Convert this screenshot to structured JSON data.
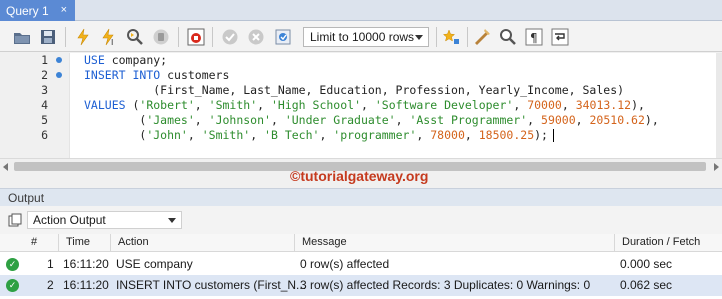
{
  "tab": {
    "label": "Query 1",
    "close": "×"
  },
  "toolbar": {
    "limit_label": "Limit to 10000 rows",
    "icons": [
      "open-folder-icon",
      "save-icon",
      "execute-icon",
      "execute-current-icon",
      "explain-icon",
      "stop-icon",
      "toggle-error-icon",
      "commit-icon",
      "rollback-icon",
      "autocommit-icon",
      "limit-dropdown",
      "beautify-icon",
      "snippet-icon",
      "find-icon",
      "invisible-chars-icon",
      "wrap-icon"
    ]
  },
  "editor": {
    "line_numbers": [
      "1",
      "2",
      "3",
      "4",
      "5",
      "6"
    ],
    "lines": [
      [
        {
          "t": "USE",
          "c": "kw"
        },
        {
          "t": " company;",
          "c": "pl"
        }
      ],
      [
        {
          "t": "INSERT INTO",
          "c": "kw"
        },
        {
          "t": " customers",
          "c": "pl"
        }
      ],
      [
        {
          "t": "          (First_Name, Last_Name, Education, Profession, Yearly_Income, Sales)",
          "c": "pl"
        }
      ],
      [
        {
          "t": "VALUES",
          "c": "kw"
        },
        {
          "t": " (",
          "c": "pl"
        },
        {
          "t": "'Robert'",
          "c": "st"
        },
        {
          "t": ", ",
          "c": "pl"
        },
        {
          "t": "'Smith'",
          "c": "st"
        },
        {
          "t": ", ",
          "c": "pl"
        },
        {
          "t": "'High School'",
          "c": "st"
        },
        {
          "t": ", ",
          "c": "pl"
        },
        {
          "t": "'Software Developer'",
          "c": "st"
        },
        {
          "t": ", ",
          "c": "pl"
        },
        {
          "t": "70000",
          "c": "nm"
        },
        {
          "t": ", ",
          "c": "pl"
        },
        {
          "t": "34013.12",
          "c": "nm"
        },
        {
          "t": "),",
          "c": "pl"
        }
      ],
      [
        {
          "t": "        (",
          "c": "pl"
        },
        {
          "t": "'James'",
          "c": "st"
        },
        {
          "t": ", ",
          "c": "pl"
        },
        {
          "t": "'Johnson'",
          "c": "st"
        },
        {
          "t": ", ",
          "c": "pl"
        },
        {
          "t": "'Under Graduate'",
          "c": "st"
        },
        {
          "t": ", ",
          "c": "pl"
        },
        {
          "t": "'Asst Programmer'",
          "c": "st"
        },
        {
          "t": ", ",
          "c": "pl"
        },
        {
          "t": "59000",
          "c": "nm"
        },
        {
          "t": ", ",
          "c": "pl"
        },
        {
          "t": "20510.62",
          "c": "nm"
        },
        {
          "t": "),",
          "c": "pl"
        }
      ],
      [
        {
          "t": "        (",
          "c": "pl"
        },
        {
          "t": "'John'",
          "c": "st"
        },
        {
          "t": ", ",
          "c": "pl"
        },
        {
          "t": "'Smith'",
          "c": "st"
        },
        {
          "t": ", ",
          "c": "pl"
        },
        {
          "t": "'B Tech'",
          "c": "st"
        },
        {
          "t": ", ",
          "c": "pl"
        },
        {
          "t": "'programmer'",
          "c": "st"
        },
        {
          "t": ", ",
          "c": "pl"
        },
        {
          "t": "78000",
          "c": "nm"
        },
        {
          "t": ", ",
          "c": "pl"
        },
        {
          "t": "18500.25",
          "c": "nm"
        },
        {
          "t": ");",
          "c": "pl"
        }
      ]
    ],
    "marked_lines": [
      1,
      2
    ]
  },
  "watermark": "©tutorialgateway.org",
  "output": {
    "title": "Output",
    "selector": "Action Output",
    "columns": {
      "num": "#",
      "time": "Time",
      "action": "Action",
      "message": "Message",
      "duration": "Duration / Fetch"
    },
    "rows": [
      {
        "num": "1",
        "time": "16:11:20",
        "action": "USE company",
        "message": "0 row(s) affected",
        "duration": "0.000 sec"
      },
      {
        "num": "2",
        "time": "16:11:20",
        "action": "INSERT INTO customers  (First_N...",
        "message": "3 row(s) affected Records: 3  Duplicates: 0  Warnings: 0",
        "duration": "0.062 sec"
      }
    ]
  },
  "colors": {
    "tab_active": "#5b8ad4",
    "keyword": "#1d5fd3",
    "string": "#2d8c2d",
    "number": "#d4641c",
    "success": "#2ea043",
    "selected_row": "#dde6f4"
  }
}
